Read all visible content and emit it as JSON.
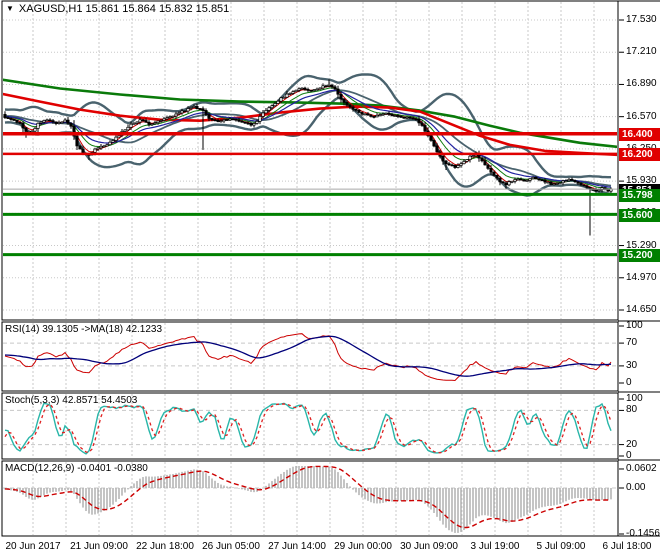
{
  "window": {
    "title": "XAGUSD,H1 15.861 15.864 15.832 15.851",
    "symbol": "XAGUSD",
    "period": "H1",
    "ohlc": {
      "open": "15.861",
      "high": "15.864",
      "low": "15.832",
      "close": "15.851"
    }
  },
  "colors": {
    "background": "#ffffff",
    "border": "#000000",
    "grid": "#c8c8c8",
    "level_red": "#e00000",
    "level_green": "#008000",
    "bid_gray": "#a8a8a8",
    "badge_red": "#e00000",
    "badge_green": "#008000",
    "badge_black": "#000000",
    "bollinger": "#4a636e",
    "ma_red": "#e00000",
    "ma_green": "#0a7a0a",
    "ema_fast_red": "#d00000",
    "ema_fast_green": "#0f7d0f",
    "ema_fast_blue": "#2222a0",
    "rsi_line": "#cc0000",
    "rsi_ma": "#00007a",
    "stoch_k": "#29b6a9",
    "stoch_d": "#e02020",
    "macd_hist": "#b0b0b0",
    "macd_signal": "#cc0000",
    "candle": "#000000"
  },
  "chart_data": {
    "type": "candlestick-multi-panel",
    "symbol_title": "XAGUSD,H1 15.861 15.864 15.832 15.851",
    "x_labels": [
      "20 Jun 2017",
      "21 Jun 09:00",
      "22 Jun 18:00",
      "26 Jun 05:00",
      "27 Jun 14:00",
      "29 Jun 00:00",
      "30 Jun 09:00",
      "3 Jul 19:00",
      "5 Jul 09:00",
      "6 Jul 18:00"
    ],
    "main": {
      "y_ticks": [
        "17.530",
        "17.210",
        "16.890",
        "16.570",
        "16.250",
        "15.930",
        "15.610",
        "15.290",
        "14.970",
        "14.650"
      ],
      "ylim": [
        14.65,
        17.53
      ],
      "levels": [
        {
          "price": 16.4,
          "badge": "16.400",
          "color": "#e00000",
          "badge_bg": "#e00000",
          "thickness": 3.5
        },
        {
          "price": 16.2,
          "badge": "16.200",
          "color": "#e00000",
          "badge_bg": "#e00000",
          "thickness": 2.5
        },
        {
          "price": 15.851,
          "badge": "15.851",
          "color": "#a8a8a8",
          "badge_bg": "#000000",
          "thickness": 1
        },
        {
          "price": 15.798,
          "badge": "15.798",
          "color": "#008000",
          "badge_bg": "#008000",
          "thickness": 3
        },
        {
          "price": 15.6,
          "badge": "15.600",
          "color": "#008000",
          "badge_bg": "#008000",
          "thickness": 3
        },
        {
          "price": 15.2,
          "badge": "15.200",
          "color": "#008000",
          "badge_bg": "#008000",
          "thickness": 3
        }
      ],
      "close_path": [
        [
          0,
          16.56
        ],
        [
          3,
          16.53
        ],
        [
          5,
          16.5
        ],
        [
          7,
          16.43
        ],
        [
          9,
          16.42
        ],
        [
          11,
          16.5
        ],
        [
          14,
          16.54
        ],
        [
          17,
          16.5
        ],
        [
          20,
          16.53
        ],
        [
          22,
          16.47
        ],
        [
          24,
          16.28
        ],
        [
          26,
          16.21
        ],
        [
          28,
          16.19
        ],
        [
          30,
          16.25
        ],
        [
          33,
          16.28
        ],
        [
          36,
          16.33
        ],
        [
          39,
          16.42
        ],
        [
          42,
          16.49
        ],
        [
          45,
          16.54
        ],
        [
          48,
          16.5
        ],
        [
          51,
          16.52
        ],
        [
          55,
          16.57
        ],
        [
          59,
          16.62
        ],
        [
          63,
          16.67
        ],
        [
          66,
          16.63
        ],
        [
          68,
          16.55
        ],
        [
          71,
          16.52
        ],
        [
          75,
          16.55
        ],
        [
          79,
          16.52
        ],
        [
          82,
          16.49
        ],
        [
          84,
          16.53
        ],
        [
          86,
          16.6
        ],
        [
          89,
          16.68
        ],
        [
          92,
          16.75
        ],
        [
          95,
          16.81
        ],
        [
          99,
          16.85
        ],
        [
          102,
          16.83
        ],
        [
          105,
          16.86
        ],
        [
          108,
          16.89
        ],
        [
          110,
          16.84
        ],
        [
          112,
          16.74
        ],
        [
          115,
          16.66
        ],
        [
          119,
          16.6
        ],
        [
          123,
          16.57
        ],
        [
          127,
          16.6
        ],
        [
          131,
          16.57
        ],
        [
          134,
          16.56
        ],
        [
          137,
          16.55
        ],
        [
          139,
          16.48
        ],
        [
          141,
          16.38
        ],
        [
          143,
          16.28
        ],
        [
          145,
          16.17
        ],
        [
          147,
          16.1
        ],
        [
          150,
          16.07
        ],
        [
          153,
          16.13
        ],
        [
          155,
          16.17
        ],
        [
          157,
          16.2
        ],
        [
          159,
          16.13
        ],
        [
          161,
          16.05
        ],
        [
          163,
          15.98
        ],
        [
          165,
          15.93
        ],
        [
          167,
          15.9
        ],
        [
          170,
          15.95
        ],
        [
          173,
          15.93
        ],
        [
          176,
          15.96
        ],
        [
          179,
          15.94
        ],
        [
          182,
          15.9
        ],
        [
          185,
          15.92
        ],
        [
          188,
          15.95
        ],
        [
          191,
          15.91
        ],
        [
          193,
          15.88
        ],
        [
          195,
          15.85
        ],
        [
          197,
          15.83
        ],
        [
          199,
          15.86
        ],
        [
          201,
          15.83
        ],
        [
          202,
          15.851
        ]
      ],
      "spikes": [
        {
          "i": 7,
          "low": 16.36
        },
        {
          "i": 28,
          "low": 16.14
        },
        {
          "i": 66,
          "low": 16.24
        },
        {
          "i": 108,
          "high": 16.94
        },
        {
          "i": 147,
          "low": 16.04
        },
        {
          "i": 167,
          "low": 15.85
        },
        {
          "i": 195,
          "low": 15.39
        }
      ],
      "ma_green_slow": [
        [
          0,
          16.94
        ],
        [
          60,
          16.85
        ],
        [
          120,
          16.79
        ],
        [
          180,
          16.74
        ],
        [
          240,
          16.72
        ],
        [
          300,
          16.71
        ],
        [
          340,
          16.7
        ],
        [
          380,
          16.68
        ],
        [
          420,
          16.63
        ],
        [
          455,
          16.57
        ],
        [
          490,
          16.48
        ],
        [
          520,
          16.41
        ],
        [
          550,
          16.36
        ],
        [
          580,
          16.31
        ],
        [
          618,
          16.27
        ]
      ],
      "ma_red_mid": [
        [
          0,
          16.8
        ],
        [
          40,
          16.72
        ],
        [
          80,
          16.64
        ],
        [
          120,
          16.58
        ],
        [
          160,
          16.54
        ],
        [
          200,
          16.53
        ],
        [
          240,
          16.56
        ],
        [
          280,
          16.61
        ],
        [
          320,
          16.65
        ],
        [
          355,
          16.67
        ],
        [
          390,
          16.66
        ],
        [
          420,
          16.62
        ],
        [
          450,
          16.5
        ],
        [
          480,
          16.38
        ],
        [
          510,
          16.29
        ],
        [
          545,
          16.23
        ],
        [
          580,
          16.21
        ],
        [
          618,
          16.19
        ]
      ],
      "bollinger": {
        "period": 20,
        "deviation": 2.2
      },
      "fast_ma_periods": {
        "red": 4,
        "green": 9,
        "blue": 15
      }
    },
    "rsi": {
      "label": "RSI(14) 39.1305  ->MA(18) 42.1233",
      "period": 14,
      "ma_period": 18,
      "value": 39.1305,
      "ma_value": 42.1233,
      "ticks": [
        "100",
        "70",
        "30",
        "0"
      ],
      "levels": [
        70,
        30
      ]
    },
    "stoch": {
      "label": "Stoch(5,3,3) 42.8571 54.4503",
      "k": 5,
      "d": 3,
      "slowing": 3,
      "value_k": 42.8571,
      "value_d": 54.4503,
      "ticks": [
        "100",
        "80",
        "20",
        "0"
      ],
      "levels": [
        80,
        20
      ]
    },
    "macd": {
      "label": "MACD(12,26,9) -0.0401 -0.0380",
      "fast": 12,
      "slow": 26,
      "signal_period": 9,
      "value": -0.0401,
      "signal_value": -0.038,
      "ticks": [
        "0.0602",
        "0.00",
        "-0.1456"
      ],
      "ylim": [
        -0.1456,
        0.0602
      ]
    }
  }
}
